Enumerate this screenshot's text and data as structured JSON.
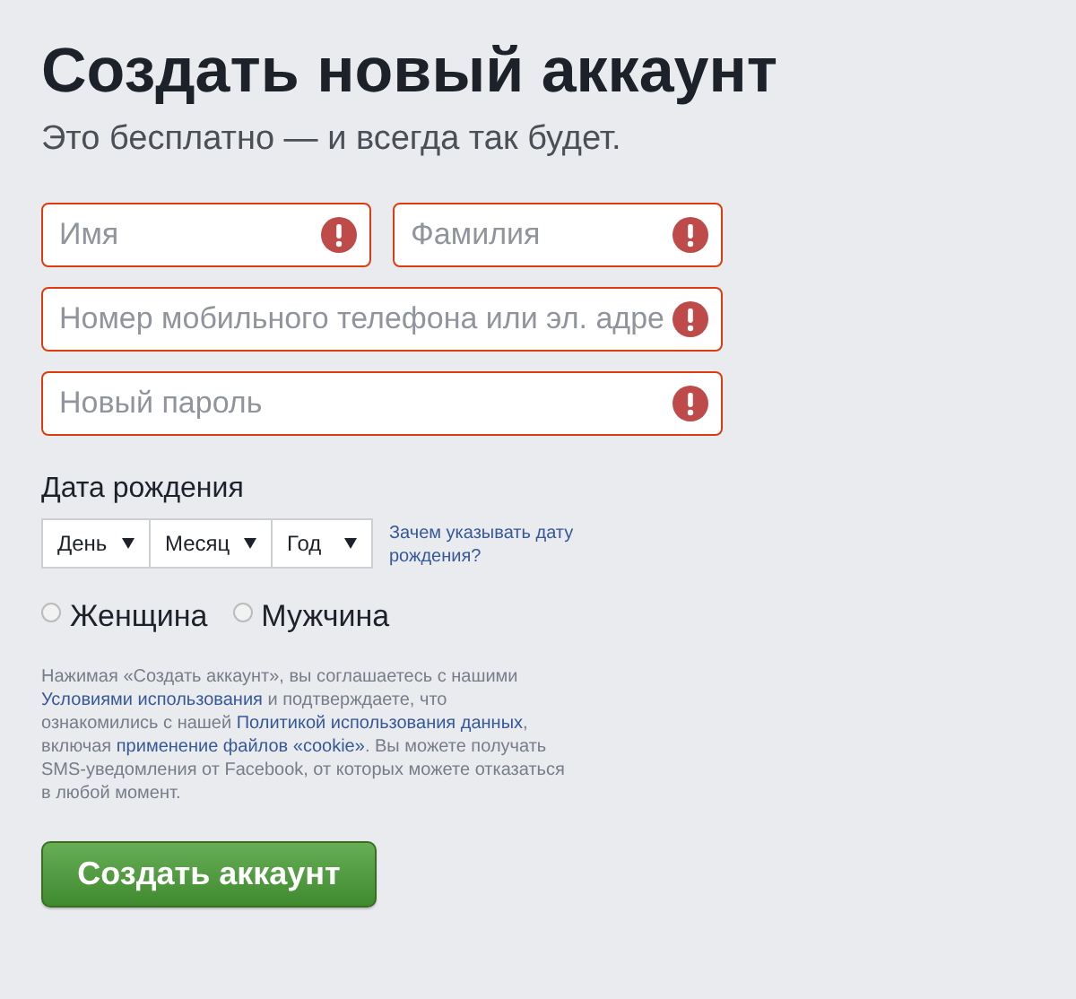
{
  "title": "Создать новый аккаунт",
  "subtitle": "Это бесплатно — и всегда так будет.",
  "fields": [
    {
      "placeholder": "Имя",
      "error": true,
      "kind": "half"
    },
    {
      "placeholder": "Фамилия",
      "error": true,
      "kind": "half"
    },
    {
      "placeholder": "Номер мобильного телефона или эл. адре",
      "error": true,
      "kind": "full"
    },
    {
      "placeholder": "Новый пароль",
      "error": true,
      "kind": "full"
    }
  ],
  "birthday": {
    "label": "Дата рождения",
    "selects": [
      {
        "value": "День"
      },
      {
        "value": "Месяц"
      },
      {
        "value": "Год"
      }
    ],
    "help_link": "Зачем указывать дату рождения?"
  },
  "gender": [
    {
      "label": "Женщина",
      "selected": false
    },
    {
      "label": "Мужчина",
      "selected": false
    }
  ],
  "terms": [
    {
      "text": "Нажимая «Создать аккаунт», вы соглашаетесь с нашими ",
      "link": false
    },
    {
      "text": "Условиями использования",
      "link": true
    },
    {
      "text": " и подтверждаете, что ознакомились с нашей ",
      "link": false
    },
    {
      "text": "Политикой использования данных",
      "link": true
    },
    {
      "text": ", включая ",
      "link": false
    },
    {
      "text": "применение файлов «cookie»",
      "link": true
    },
    {
      "text": ". Вы можете получать SMS-уведомления от Facebook, от которых можете отказаться в любой момент.",
      "link": false
    }
  ],
  "submit": "Создать аккаунт"
}
